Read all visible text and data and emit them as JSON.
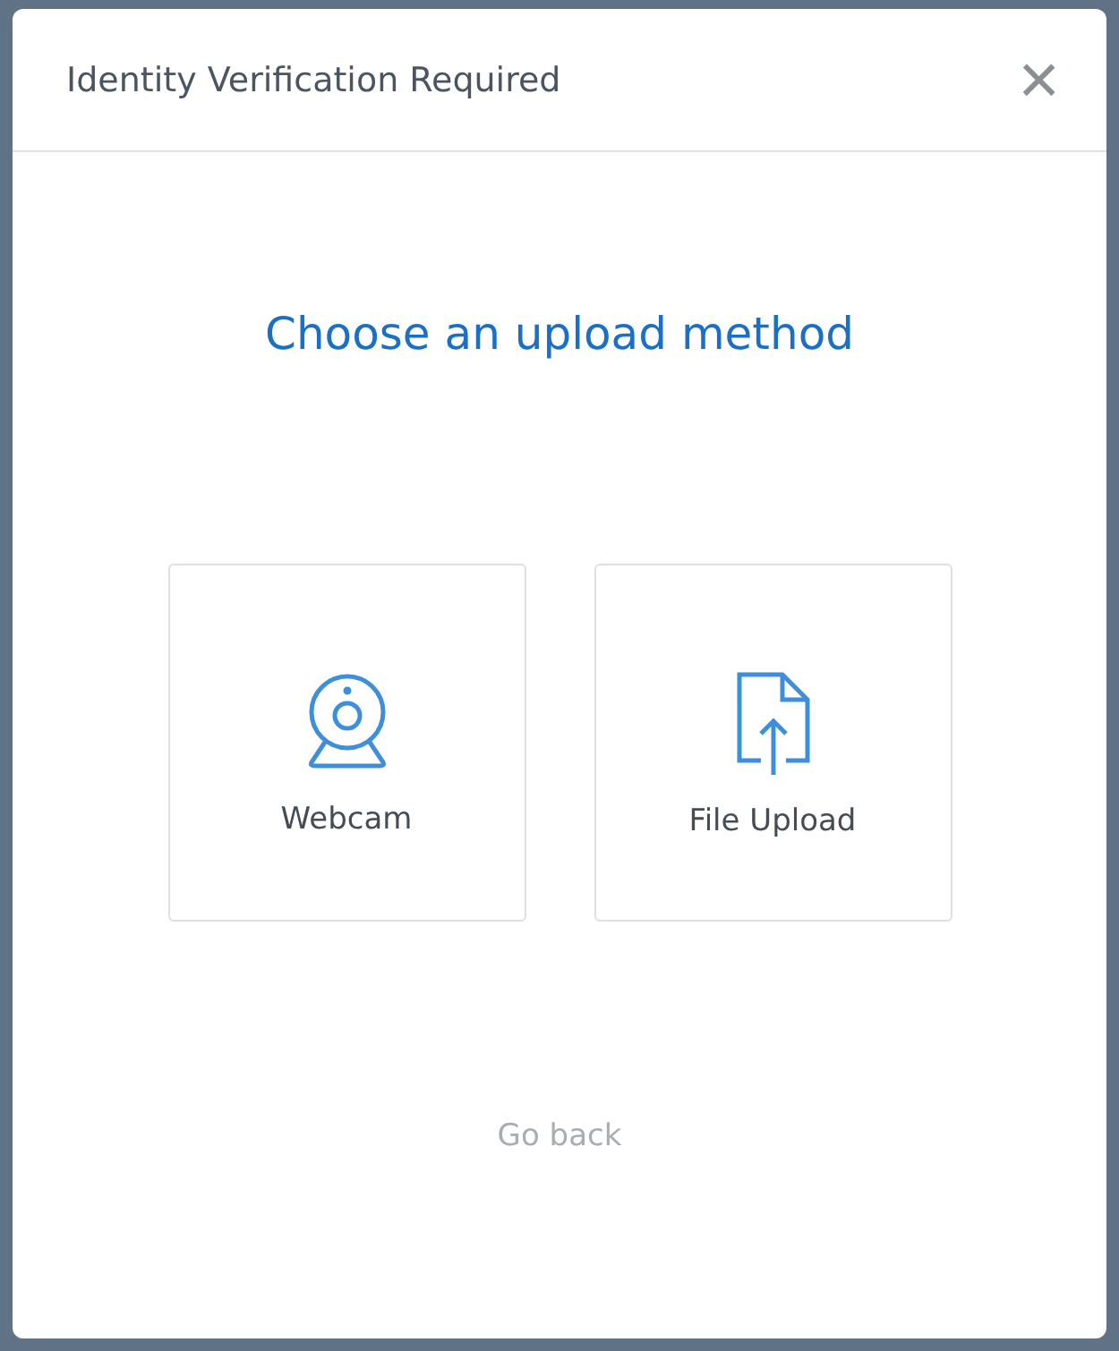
{
  "dialog": {
    "title": "Identity Verification Required",
    "close": "×"
  },
  "heading": "Choose an upload method",
  "options": [
    {
      "kind": "webcam",
      "label": "Webcam"
    },
    {
      "kind": "file",
      "label": "File Upload"
    }
  ],
  "back_link": "Go back"
}
